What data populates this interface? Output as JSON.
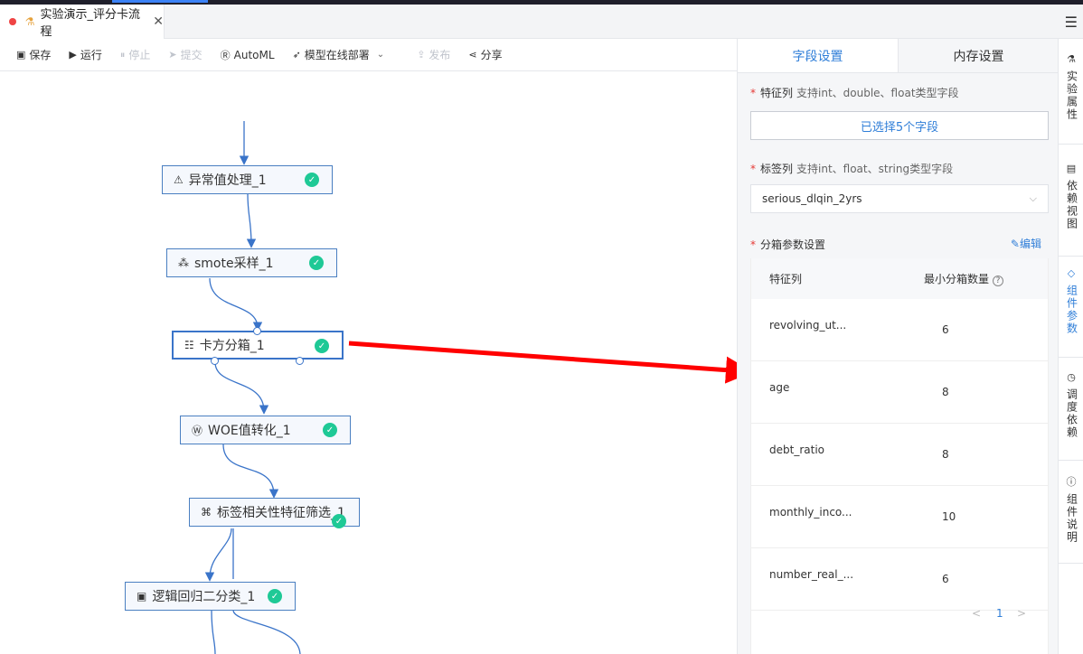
{
  "window": {
    "tab_title": "实验演示_评分卡流程",
    "close_glyph": "✕",
    "menu_icon": "list-icon"
  },
  "toolbar": {
    "items": [
      {
        "label": "保存",
        "icon": "save-icon",
        "enabled": true
      },
      {
        "label": "运行",
        "icon": "play-icon",
        "enabled": true
      },
      {
        "label": "停止",
        "icon": "stop-icon",
        "enabled": false
      },
      {
        "label": "提交",
        "icon": "send-icon",
        "enabled": false
      },
      {
        "label": "AutoML",
        "icon": "automl-icon",
        "enabled": true
      },
      {
        "label": "模型在线部署",
        "icon": "rocket-icon",
        "enabled": true
      },
      {
        "label": "发布",
        "icon": "publish-icon",
        "enabled": false
      },
      {
        "label": "分享",
        "icon": "share-icon",
        "enabled": true
      }
    ]
  },
  "canvas": {
    "nodes": [
      {
        "label": "异常值处理_1",
        "icon": "warning-icon",
        "status": "success"
      },
      {
        "label": "smote采样_1",
        "icon": "sampling-icon",
        "status": "success"
      },
      {
        "label": "卡方分箱_1",
        "icon": "binning-icon",
        "status": "success",
        "selected": true
      },
      {
        "label": "WOE值转化_1",
        "icon": "woe-icon",
        "status": "success"
      },
      {
        "label": "标签相关性特征筛选_1",
        "icon": "tag-icon",
        "status": "success"
      },
      {
        "label": "逻辑回归二分类_1",
        "icon": "robot-icon",
        "status": "success"
      }
    ],
    "annotation_arrow_color": "#ff0000"
  },
  "panel": {
    "tabs": [
      {
        "label": "字段设置",
        "active": true
      },
      {
        "label": "内存设置",
        "active": false
      }
    ],
    "feature_col": {
      "label": "特征列",
      "hint": "支持int、double、float类型字段",
      "button": "已选择5个字段"
    },
    "label_col": {
      "label": "标签列",
      "hint": "支持int、float、string类型字段",
      "value": "serious_dlqin_2yrs"
    },
    "binning": {
      "label": "分箱参数设置",
      "edit": "编辑",
      "headers": [
        "特征列",
        "最小分箱数量"
      ],
      "rows": [
        {
          "feature": "revolving_ut...",
          "min_bins": "6"
        },
        {
          "feature": "age",
          "min_bins": "8"
        },
        {
          "feature": "debt_ratio",
          "min_bins": "8"
        },
        {
          "feature": "monthly_inco...",
          "min_bins": "10"
        },
        {
          "feature": "number_real_...",
          "min_bins": "6"
        }
      ],
      "pager": {
        "prev": "<",
        "page": "1",
        "next": ">"
      }
    }
  },
  "rail": {
    "items": [
      {
        "label": "实验属性",
        "icon": "flask-icon",
        "active": false
      },
      {
        "label": "依赖视图",
        "icon": "table-icon",
        "active": false
      },
      {
        "label": "组件参数",
        "icon": "tag-icon",
        "active": true
      },
      {
        "label": "调度依赖",
        "icon": "clock-icon",
        "active": false
      },
      {
        "label": "组件说明",
        "icon": "info-icon",
        "active": false
      }
    ]
  },
  "colors": {
    "accent": "#2f7ed8",
    "success": "#1fc996",
    "required": "#e53935",
    "node_border": "#4a7fc1",
    "edge": "#3a74c9"
  }
}
